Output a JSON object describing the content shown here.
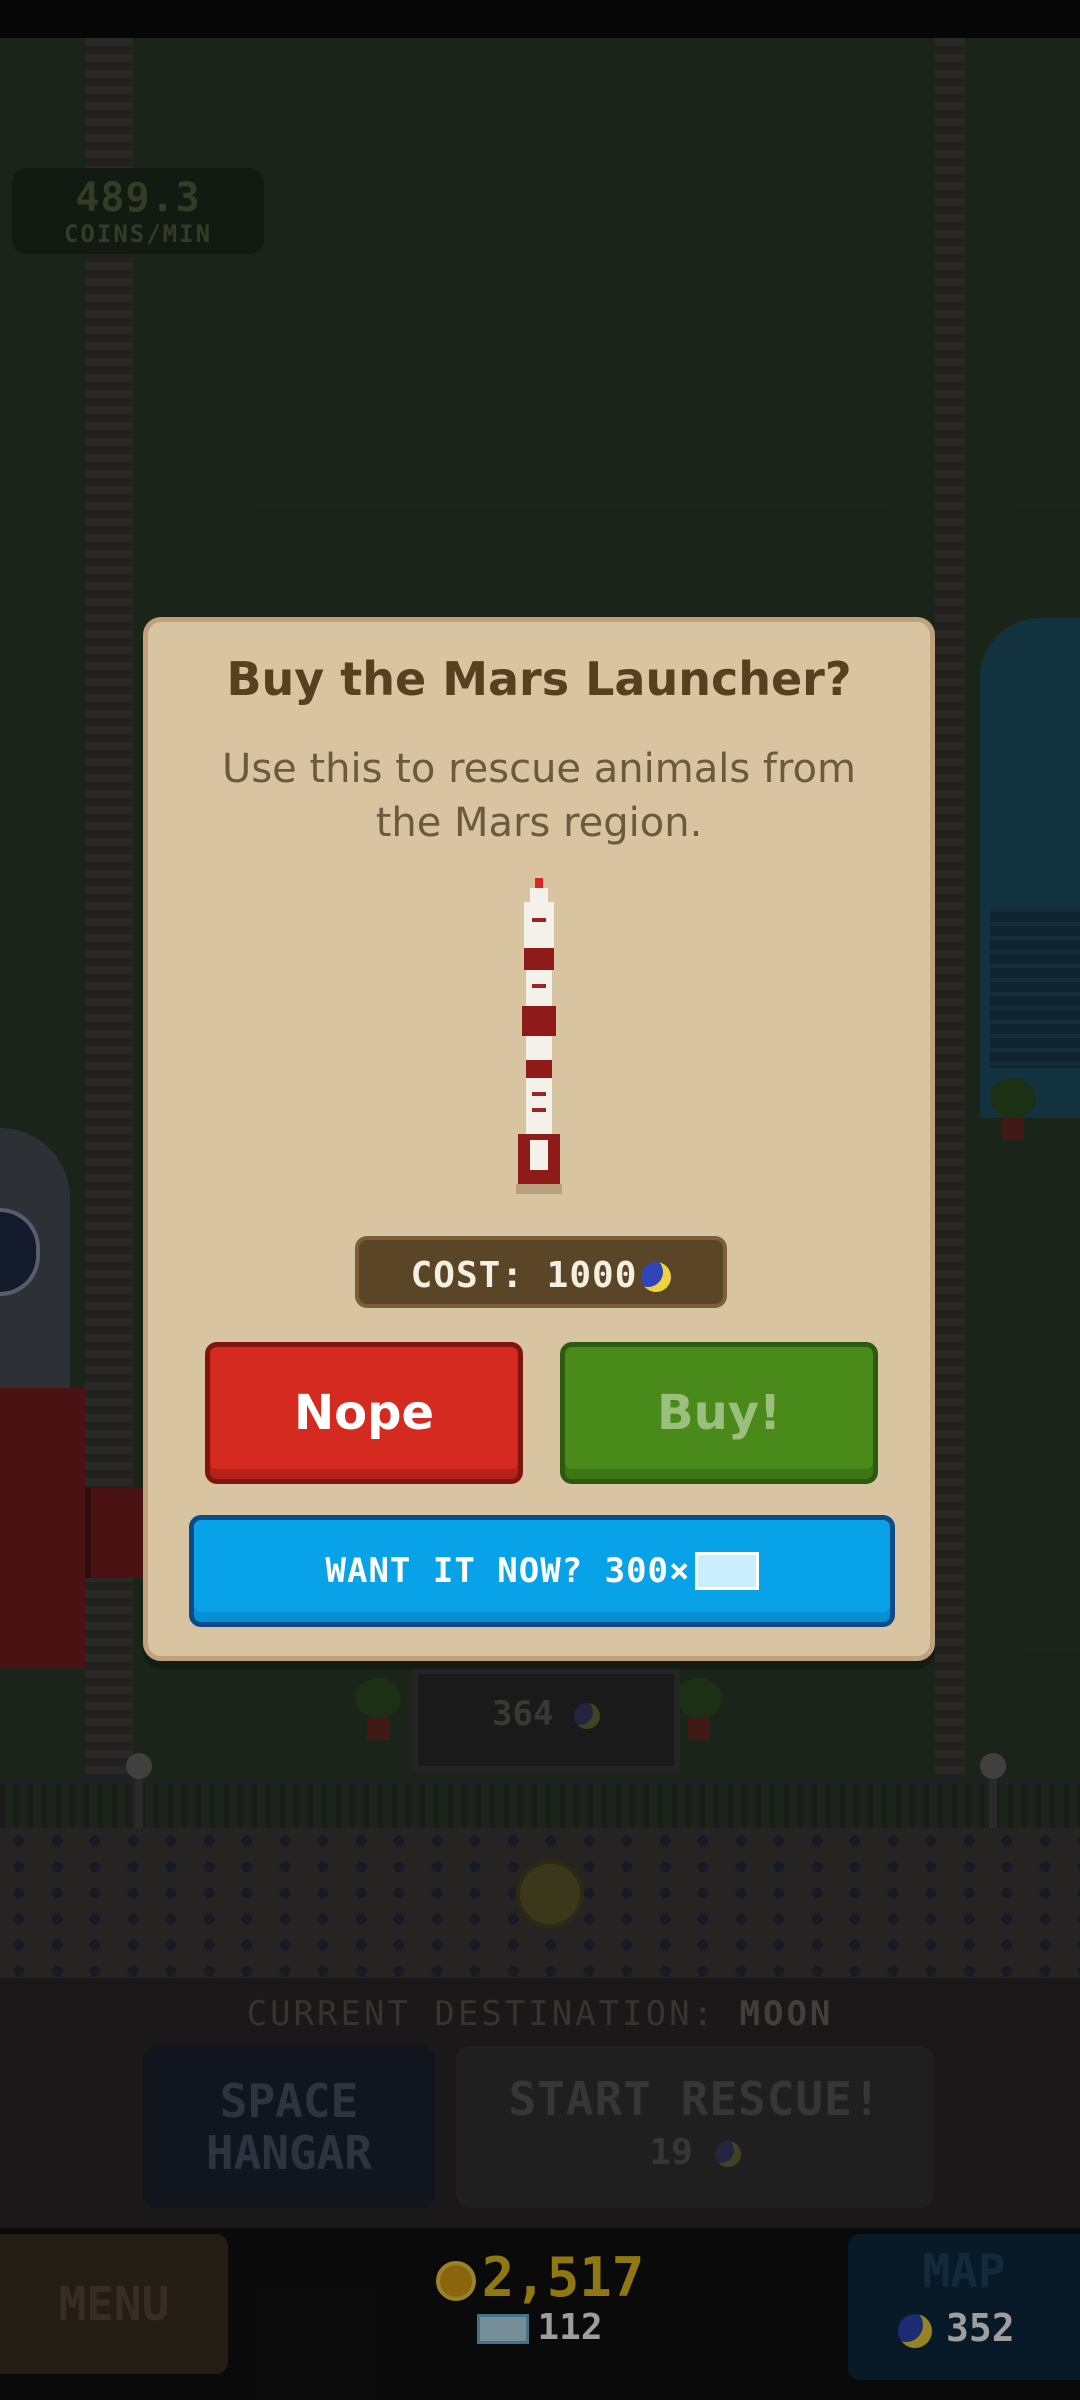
{
  "background": {
    "rate": {
      "value": "489.3",
      "unit": "COINS/MIN"
    },
    "sign_value": "364"
  },
  "bottom_panel": {
    "destination_label": "CURRENT DESTINATION:",
    "destination_value": "MOON",
    "hangar_line1": "SPACE",
    "hangar_line2": "HANGAR",
    "rescue_label": "START RESCUE!",
    "rescue_cost": "19"
  },
  "footer": {
    "menu_label": "MENU",
    "coins": "2,517",
    "gems": "112",
    "map_label": "MAP",
    "moons": "352"
  },
  "dialog": {
    "title": "Buy the Mars Launcher?",
    "description": "Use this to rescue animals from the Mars region.",
    "cost_label": "COST: 1000",
    "nope_label": "Nope",
    "buy_label": "Buy!",
    "want_now_label": "WANT IT NOW? 300×"
  },
  "colors": {
    "dialog_bg": "#d8c4a1",
    "nope": "#d42a20",
    "buy": "#4a8a1a",
    "want_now": "#08a2e8",
    "coin_text": "#e8c21c"
  },
  "icons": [
    "gold-coin-icon",
    "gem-icon",
    "moon-currency-icon",
    "rocket-icon"
  ]
}
